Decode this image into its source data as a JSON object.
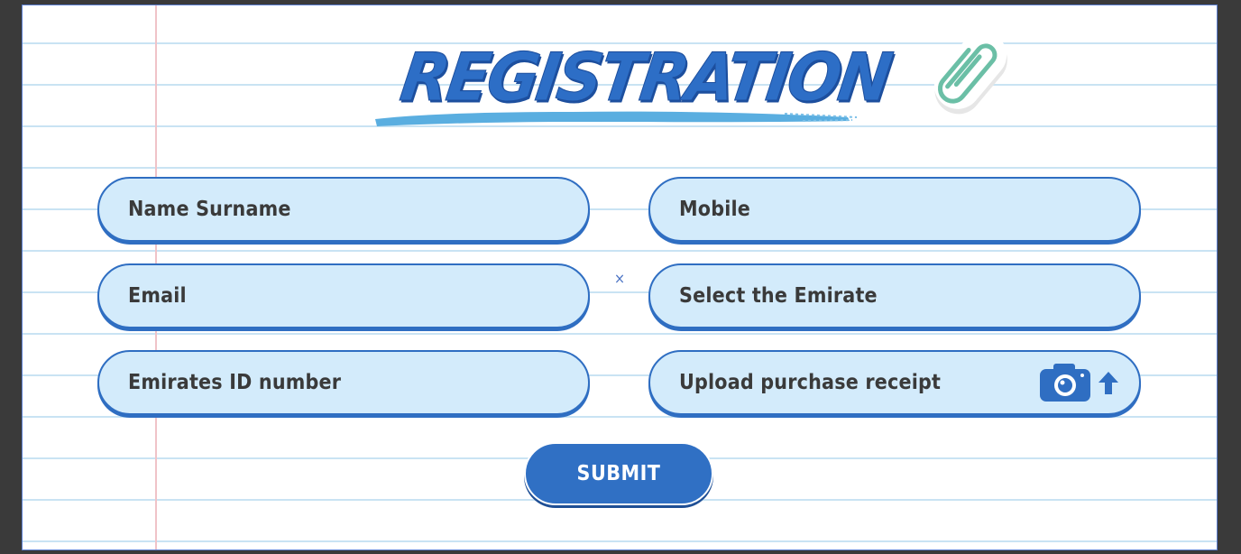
{
  "form": {
    "title": "REGISTRATION",
    "fields": {
      "name": "Name Surname",
      "mobile": "Mobile",
      "email": "Email",
      "emirate": "Select the Emirate",
      "emirates_id": "Emirates ID number",
      "upload": "Upload purchase receipt"
    },
    "close_symbol": "×",
    "submit_label": "SUBMIT"
  },
  "icons": {
    "paperclip": "paperclip-icon",
    "camera": "camera-icon",
    "upload_arrow": "arrow-up-icon"
  },
  "colors": {
    "accent": "#2f6ec2",
    "field_fill": "#d3ebfb",
    "title": "#2d6ec6",
    "paperclip": "#6bbfa6",
    "ruled_line": "#c9e3f3",
    "margin_line": "#f0c3c8"
  }
}
